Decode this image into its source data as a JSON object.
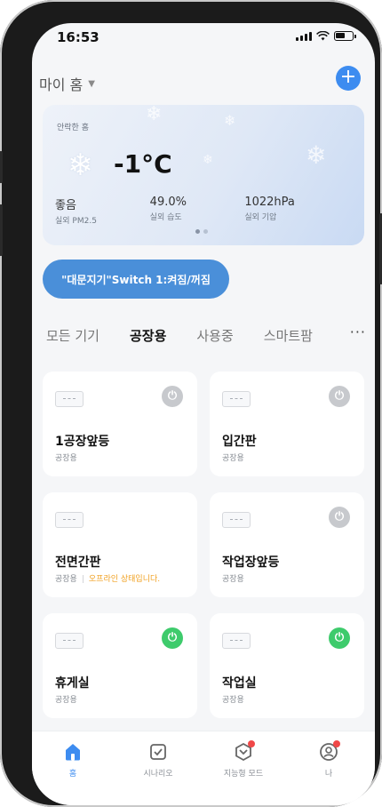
{
  "status_bar": {
    "time": "16:53"
  },
  "header": {
    "home_name": "마이 홈",
    "add_label": "+"
  },
  "weather": {
    "label": "안락한 홈",
    "temperature": "-1°C",
    "stats": [
      {
        "value": "좋음",
        "label": "실외 PM2.5"
      },
      {
        "value": "49.0%",
        "label": "실외 습도"
      },
      {
        "value": "1022hPa",
        "label": "실외 기압"
      }
    ],
    "pages": 2,
    "active_page": 1
  },
  "scene": {
    "label": "\"대문지기\"Switch 1:켜짐/꺼짐"
  },
  "tabs": [
    {
      "label": "모든 기기",
      "active": false
    },
    {
      "label": "공장용",
      "active": true
    },
    {
      "label": "사용중",
      "active": false
    },
    {
      "label": "스마트팜",
      "active": false
    }
  ],
  "more_label": "···",
  "devices": [
    {
      "name": "1공장앞등",
      "room": "공장용",
      "power": "off",
      "status": ""
    },
    {
      "name": "입간판",
      "room": "공장용",
      "power": "off",
      "status": ""
    },
    {
      "name": "전면간판",
      "room": "공장용",
      "power": "none",
      "status": "오프라인 상태입니다."
    },
    {
      "name": "작업장앞등",
      "room": "공장용",
      "power": "off",
      "status": ""
    },
    {
      "name": "휴게실",
      "room": "공장용",
      "power": "on",
      "status": ""
    },
    {
      "name": "작업실",
      "room": "공장용",
      "power": "on",
      "status": ""
    }
  ],
  "colors": {
    "accent": "#3d8cf0",
    "power_on": "#3ecb6c",
    "power_off": "#c7c9cd",
    "offline": "#f0a020",
    "badge": "#f04848"
  },
  "nav": [
    {
      "label": "홈",
      "icon": "home-icon",
      "active": true,
      "badge": false
    },
    {
      "label": "시나리오",
      "icon": "checkbox-icon",
      "active": false,
      "badge": false
    },
    {
      "label": "지능형 모드",
      "icon": "smart-mode-icon",
      "active": false,
      "badge": true
    },
    {
      "label": "나",
      "icon": "profile-icon",
      "active": false,
      "badge": true
    }
  ]
}
